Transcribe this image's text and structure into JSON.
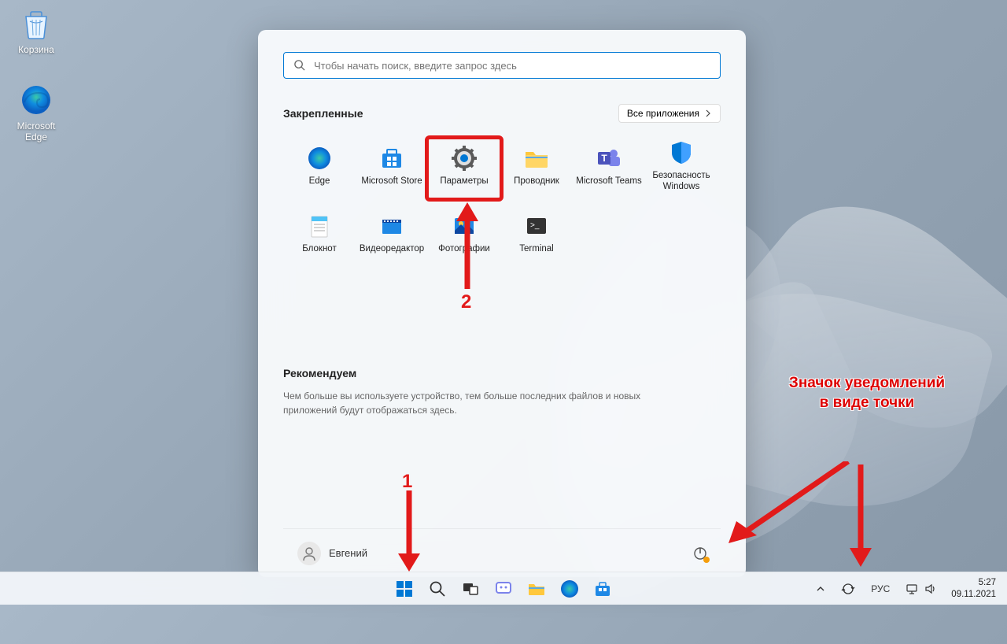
{
  "desktop": {
    "icons": [
      {
        "name": "recycle-bin",
        "label": "Корзина"
      },
      {
        "name": "microsoft-edge",
        "label": "Microsoft Edge"
      }
    ]
  },
  "start_menu": {
    "search_placeholder": "Чтобы начать поиск, введите запрос здесь",
    "pinned_title": "Закрепленные",
    "all_apps_label": "Все приложения",
    "apps": [
      {
        "name": "edge",
        "label": "Edge"
      },
      {
        "name": "microsoft-store",
        "label": "Microsoft Store"
      },
      {
        "name": "settings",
        "label": "Параметры"
      },
      {
        "name": "explorer",
        "label": "Проводник"
      },
      {
        "name": "teams",
        "label": "Microsoft Teams"
      },
      {
        "name": "windows-security",
        "label": "Безопасность Windows"
      },
      {
        "name": "notepad",
        "label": "Блокнот"
      },
      {
        "name": "video-editor",
        "label": "Видеоредактор"
      },
      {
        "name": "photos",
        "label": "Фотографии"
      },
      {
        "name": "terminal",
        "label": "Terminal"
      }
    ],
    "recommend_title": "Рекомендуем",
    "recommend_text": "Чем больше вы используете устройство, тем больше последних файлов и новых приложений будут отображаться здесь.",
    "user_name": "Евгений"
  },
  "taskbar": {
    "language": "РУС",
    "time": "5:27",
    "date": "09.11.2021"
  },
  "annotations": {
    "label1": "1",
    "label2": "2",
    "notification_text": "Значок уведомлений в виде точки"
  }
}
